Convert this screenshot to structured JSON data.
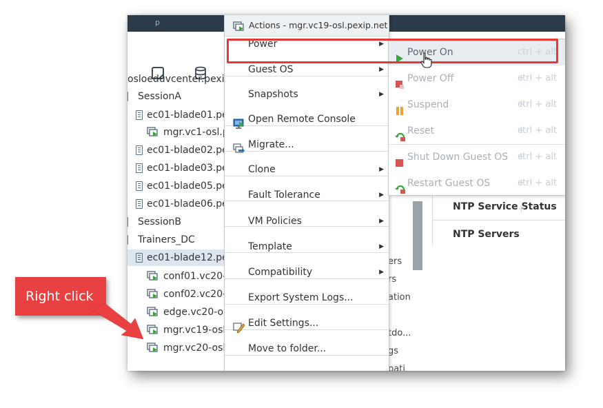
{
  "colors": {
    "topbar": "#2c3b49",
    "highlight": "#e53935",
    "callout": "#e94141",
    "selected_row": "#dde6ee",
    "vm_play_green": "#3aa53a"
  },
  "sidebar": {
    "icons": [
      "notes-icon",
      "database-icon"
    ],
    "tree": [
      {
        "label": "osloeduvcenter.pexip",
        "type": "vcenter"
      },
      {
        "label": "SessionA",
        "type": "cluster"
      },
      {
        "label": "ec01-blade01.pe",
        "type": "host"
      },
      {
        "label": "mgr.vc1-osl.pe",
        "type": "vm"
      },
      {
        "label": "ec01-blade02.pe",
        "type": "host"
      },
      {
        "label": "ec01-blade03.pe",
        "type": "host"
      },
      {
        "label": "ec01-blade05.pe",
        "type": "host"
      },
      {
        "label": "ec01-blade06.pe",
        "type": "host"
      },
      {
        "label": "SessionB",
        "type": "cluster"
      },
      {
        "label": "Trainers_DC",
        "type": "cluster"
      },
      {
        "label": "ec01-blade12.pe",
        "type": "host",
        "selected": true
      },
      {
        "label": "conf01.vc20-o",
        "type": "vm"
      },
      {
        "label": "conf02.vc20-",
        "type": "vm"
      },
      {
        "label": "edge.vc20-os",
        "type": "vm"
      },
      {
        "label": "mgr.vc19-osl.p",
        "type": "vm"
      },
      {
        "label": "mgr.vc20-osl.",
        "type": "vm"
      }
    ]
  },
  "actions_menu": {
    "title": "Actions - mgr.vc19-osl.pexip.net",
    "items": [
      {
        "label": "Power",
        "submenu": true,
        "icon": ""
      },
      {
        "label": "Guest OS",
        "submenu": true,
        "icon": ""
      },
      {
        "label": "Snapshots",
        "submenu": true,
        "icon": ""
      },
      {
        "label": "Open Remote Console",
        "submenu": false,
        "icon": "console-icon"
      },
      {
        "label": "Migrate...",
        "submenu": false,
        "icon": "migrate-icon"
      },
      {
        "label": "Clone",
        "submenu": true,
        "icon": ""
      },
      {
        "label": "Fault Tolerance",
        "submenu": true,
        "icon": ""
      },
      {
        "label": "VM Policies",
        "submenu": true,
        "icon": ""
      },
      {
        "label": "Template",
        "submenu": true,
        "icon": ""
      },
      {
        "label": "Compatibility",
        "submenu": true,
        "icon": ""
      },
      {
        "label": "Export System Logs...",
        "submenu": false,
        "icon": ""
      },
      {
        "label": "Edit Settings...",
        "submenu": false,
        "icon": "edit-settings-icon"
      },
      {
        "label": "Move to folder...",
        "submenu": false,
        "icon": ""
      }
    ]
  },
  "power_submenu": {
    "items": [
      {
        "label": "Power On",
        "shortcut": "ctrl + alt +",
        "icon": "play-icon",
        "active": true
      },
      {
        "label": "Power Off",
        "shortcut": "ctrl + alt +",
        "icon": "power-off-icon"
      },
      {
        "label": "Suspend",
        "shortcut": "ctrl + alt +",
        "icon": "pause-icon"
      },
      {
        "label": "Reset",
        "shortcut": "ctrl + alt +",
        "icon": "reset-icon"
      },
      {
        "label": "Shut Down Guest OS",
        "shortcut": "ctrl + alt +",
        "icon": "stop-icon"
      },
      {
        "label": "Restart Guest OS",
        "shortcut": "ctrl + alt +",
        "icon": "restart-icon"
      }
    ]
  },
  "right_panel": {
    "rows": [
      "NTP Service Status",
      "NTP Servers"
    ],
    "peek": [
      "ers",
      "rs",
      "ation",
      "tdo...",
      "gs",
      "pati"
    ]
  },
  "callout": {
    "text": "Right click"
  }
}
